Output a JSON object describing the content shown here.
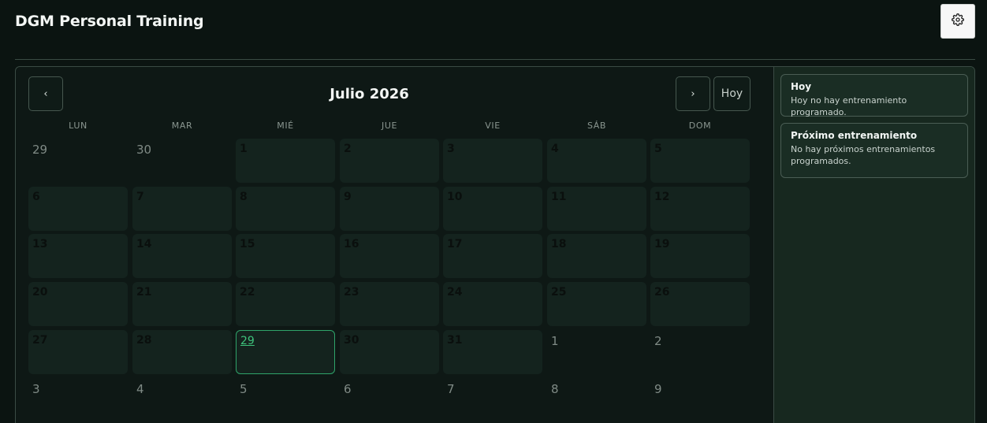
{
  "app": {
    "title": "DGM Personal Training"
  },
  "header": {
    "settings_icon": "gear-icon"
  },
  "calendar": {
    "month_title": "Julio 2026",
    "prev_label": "‹",
    "next_label": "›",
    "today_label": "Hoy",
    "weekdays": [
      "LUN",
      "MAR",
      "MIÉ",
      "JUE",
      "VIE",
      "SÁB",
      "DOM"
    ],
    "weeks": [
      [
        {
          "d": "29",
          "m": "out"
        },
        {
          "d": "30",
          "m": "out"
        },
        {
          "d": "1",
          "m": "in"
        },
        {
          "d": "2",
          "m": "in"
        },
        {
          "d": "3",
          "m": "in"
        },
        {
          "d": "4",
          "m": "in"
        },
        {
          "d": "5",
          "m": "in"
        }
      ],
      [
        {
          "d": "6",
          "m": "in"
        },
        {
          "d": "7",
          "m": "in"
        },
        {
          "d": "8",
          "m": "in"
        },
        {
          "d": "9",
          "m": "in"
        },
        {
          "d": "10",
          "m": "in"
        },
        {
          "d": "11",
          "m": "in"
        },
        {
          "d": "12",
          "m": "in"
        }
      ],
      [
        {
          "d": "13",
          "m": "in"
        },
        {
          "d": "14",
          "m": "in"
        },
        {
          "d": "15",
          "m": "in"
        },
        {
          "d": "16",
          "m": "in"
        },
        {
          "d": "17",
          "m": "in"
        },
        {
          "d": "18",
          "m": "in"
        },
        {
          "d": "19",
          "m": "in"
        }
      ],
      [
        {
          "d": "20",
          "m": "in"
        },
        {
          "d": "21",
          "m": "in"
        },
        {
          "d": "22",
          "m": "in"
        },
        {
          "d": "23",
          "m": "in"
        },
        {
          "d": "24",
          "m": "in"
        },
        {
          "d": "25",
          "m": "in"
        },
        {
          "d": "26",
          "m": "in"
        }
      ],
      [
        {
          "d": "27",
          "m": "in"
        },
        {
          "d": "28",
          "m": "in"
        },
        {
          "d": "29",
          "m": "today"
        },
        {
          "d": "30",
          "m": "in"
        },
        {
          "d": "31",
          "m": "in"
        },
        {
          "d": "1",
          "m": "out"
        },
        {
          "d": "2",
          "m": "out"
        }
      ],
      [
        {
          "d": "3",
          "m": "out"
        },
        {
          "d": "4",
          "m": "out"
        },
        {
          "d": "5",
          "m": "out"
        },
        {
          "d": "6",
          "m": "out"
        },
        {
          "d": "7",
          "m": "out"
        },
        {
          "d": "8",
          "m": "out"
        },
        {
          "d": "9",
          "m": "out"
        }
      ]
    ]
  },
  "sidebar": {
    "today_card": {
      "title": "Hoy",
      "text": "Hoy no hay entrenamiento programado."
    },
    "next_card": {
      "title": "Próximo entrenamiento",
      "text": "No hay próximos entrenamientos programados."
    }
  },
  "colors": {
    "background": "#0b1411",
    "accent": "#2fa46a",
    "cell": "#14231e",
    "sidebar": "#17281f"
  }
}
